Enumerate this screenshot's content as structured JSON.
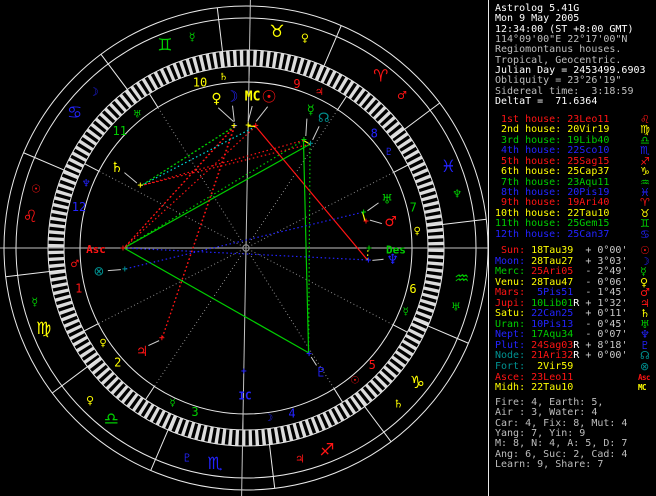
{
  "app_title": "Astrolog 5.41G",
  "palette": {
    "red": "#ff1414",
    "yellow": "#ffff00",
    "green": "#00cd00",
    "blue": "#2323ff",
    "teal": "#009191",
    "cyan": "#00e3e3",
    "white": "#ffffff",
    "gray": "#bdbdbd",
    "ltgray": "#c9c9c9",
    "dim": "#8c8c8c",
    "line": "#eaeaea",
    "axis": "#c2c2c2",
    "pointer": "#cfcfcf",
    "hatch": "#dcdcdc"
  },
  "panel": {
    "header_lines": [
      {
        "text": "Astrolog 5.41G",
        "color": "white"
      },
      {
        "text": "Mon 9 May 2005",
        "color": "white"
      },
      {
        "text": "12:34:00 (ST +8:00 GMT)",
        "color": "white"
      },
      {
        "text": "114°09'00\"E 22°17'00\"N",
        "color": "gray"
      },
      {
        "text": "Regiomontanus houses.",
        "color": "gray"
      },
      {
        "text": "Tropical, Geocentric.",
        "color": "gray"
      },
      {
        "text": "Julian Day = 2453499.6903",
        "color": "white"
      },
      {
        "text": "Obliquity = 23°26'19\"",
        "color": "gray"
      },
      {
        "text": "Sidereal time:  3:18:59",
        "color": "gray"
      },
      {
        "text": "DeltaT =  71.6364",
        "color": "white"
      }
    ],
    "houses": [
      {
        "label": " 1st house:",
        "value": "23Leo11",
        "color": "red",
        "glyph": "♌"
      },
      {
        "label": " 2nd house:",
        "value": "20Vir19",
        "color": "yellow",
        "glyph": "♍"
      },
      {
        "label": " 3rd house:",
        "value": "19Lib40",
        "color": "green",
        "glyph": "♎"
      },
      {
        "label": " 4th house:",
        "value": "22Sco10",
        "color": "blue",
        "glyph": "♏"
      },
      {
        "label": " 5th house:",
        "value": "25Sag15",
        "color": "red",
        "glyph": "♐"
      },
      {
        "label": " 6th house:",
        "value": "25Cap37",
        "color": "yellow",
        "glyph": "♑"
      },
      {
        "label": " 7th house:",
        "value": "23Aqu11",
        "color": "green",
        "glyph": "♒"
      },
      {
        "label": " 8th house:",
        "value": "20Pis19",
        "color": "blue",
        "glyph": "♓"
      },
      {
        "label": " 9th house:",
        "value": "19Ari40",
        "color": "red",
        "glyph": "♈"
      },
      {
        "label": "10th house:",
        "value": "22Tau10",
        "color": "yellow",
        "glyph": "♉"
      },
      {
        "label": "11th house:",
        "value": "25Gem15",
        "color": "green",
        "glyph": "♊"
      },
      {
        "label": "12th house:",
        "value": "25Can37",
        "color": "blue",
        "glyph": "♋"
      }
    ],
    "planets": [
      {
        "label": " Sun:",
        "value": "18Tau39",
        "retro": " ",
        "dev": "+ 0°00'",
        "label_color": "red",
        "value_color": "yellow",
        "glyph": "☉",
        "glyph_color": "red"
      },
      {
        "label": "Moon:",
        "value": "28Tau27",
        "retro": " ",
        "dev": "+ 3°03'",
        "label_color": "blue",
        "value_color": "yellow",
        "glyph": "☽",
        "glyph_color": "blue"
      },
      {
        "label": "Merc:",
        "value": "25Ari05",
        "retro": " ",
        "dev": "- 2°49'",
        "label_color": "green",
        "value_color": "red",
        "glyph": "☿",
        "glyph_color": "green"
      },
      {
        "label": "Venu:",
        "value": "28Tau47",
        "retro": " ",
        "dev": "- 0°06'",
        "label_color": "yellow",
        "value_color": "yellow",
        "glyph": "♀",
        "glyph_color": "yellow"
      },
      {
        "label": "Mars:",
        "value": " 5Pis51",
        "retro": " ",
        "dev": "- 1°45'",
        "label_color": "red",
        "value_color": "blue",
        "glyph": "♂",
        "glyph_color": "red"
      },
      {
        "label": "Jupi:",
        "value": "10Lib01",
        "retro": "R",
        "dev": "+ 1°32'",
        "label_color": "red",
        "value_color": "green",
        "glyph": "♃",
        "glyph_color": "red"
      },
      {
        "label": "Satu:",
        "value": "22Can25",
        "retro": " ",
        "dev": "+ 0°11'",
        "label_color": "yellow",
        "value_color": "blue",
        "glyph": "♄",
        "glyph_color": "yellow"
      },
      {
        "label": "Uran:",
        "value": "10Pis13",
        "retro": " ",
        "dev": "- 0°45'",
        "label_color": "green",
        "value_color": "blue",
        "glyph": "♅",
        "glyph_color": "green"
      },
      {
        "label": "Nept:",
        "value": "17Aqu34",
        "retro": " ",
        "dev": "- 0°07'",
        "label_color": "blue",
        "value_color": "green",
        "glyph": "♆",
        "glyph_color": "blue"
      },
      {
        "label": "Plut:",
        "value": "24Sag03",
        "retro": "R",
        "dev": "+ 8°18'",
        "label_color": "blue",
        "value_color": "red",
        "glyph": "♇",
        "glyph_color": "blue"
      },
      {
        "label": "Node:",
        "value": "21Ari32",
        "retro": "R",
        "dev": "+ 0°00'",
        "label_color": "teal",
        "value_color": "red",
        "glyph": "☊",
        "glyph_color": "teal"
      },
      {
        "label": "Fort:",
        "value": " 2Vir59",
        "retro": " ",
        "dev": "",
        "label_color": "teal",
        "value_color": "yellow",
        "glyph": "⊗",
        "glyph_color": "teal"
      },
      {
        "label": "Asce:",
        "value": "23Leo11",
        "retro": " ",
        "dev": "",
        "label_color": "red",
        "value_color": "red",
        "glyph": "Asc",
        "glyph_color": "red",
        "glyph_text": true
      },
      {
        "label": "Midh:",
        "value": "22Tau10",
        "retro": " ",
        "dev": "",
        "label_color": "yellow",
        "value_color": "yellow",
        "glyph": "MC",
        "glyph_color": "yellow",
        "glyph_text": true
      }
    ],
    "stats_lines": [
      "Fire: 4, Earth: 5,",
      "Air : 3, Water: 4",
      "Car: 4, Fix: 8, Mut: 4",
      "Yang: 7, Yin: 9",
      "M: 8, N: 4, A: 5, D: 7",
      "Ang: 6, Suc: 2, Cad: 4",
      "Learn: 9, Share: 7"
    ]
  },
  "chart_data": {
    "type": "astrology_wheel",
    "asc_lon": 143.183,
    "house_cusps_lon": [
      143.183,
      170.317,
      199.667,
      232.167,
      265.25,
      295.617,
      323.183,
      350.317,
      19.667,
      52.167,
      85.25,
      115.617
    ],
    "house_number_colors": [
      "red",
      "yellow",
      "green",
      "blue",
      "red",
      "yellow",
      "green",
      "blue",
      "red",
      "yellow",
      "green",
      "blue"
    ],
    "house_rulers": [
      {
        "glyph": "♂",
        "color": "red"
      },
      {
        "glyph": "♀",
        "color": "yellow"
      },
      {
        "glyph": "☿",
        "color": "green"
      },
      {
        "glyph": "☽",
        "color": "blue"
      },
      {
        "glyph": "☉",
        "color": "red"
      },
      {
        "glyph": "☿",
        "color": "green"
      },
      {
        "glyph": "♀",
        "color": "yellow"
      },
      {
        "glyph": "♇",
        "color": "blue"
      },
      {
        "glyph": "♃",
        "color": "red"
      },
      {
        "glyph": "♄",
        "color": "yellow"
      },
      {
        "glyph": "♅",
        "color": "green"
      },
      {
        "glyph": "♆",
        "color": "blue"
      }
    ],
    "signs": [
      {
        "name": "Aries",
        "glyph": "♈",
        "color": "red",
        "ruler": "♂",
        "ruler_color": "red"
      },
      {
        "name": "Taurus",
        "glyph": "♉",
        "color": "yellow",
        "ruler": "♀",
        "ruler_color": "yellow"
      },
      {
        "name": "Gemini",
        "glyph": "♊",
        "color": "green",
        "ruler": "☿",
        "ruler_color": "green"
      },
      {
        "name": "Cancer",
        "glyph": "♋",
        "color": "blue",
        "ruler": "☽",
        "ruler_color": "blue"
      },
      {
        "name": "Leo",
        "glyph": "♌",
        "color": "red",
        "ruler": "☉",
        "ruler_color": "red"
      },
      {
        "name": "Virgo",
        "glyph": "♍",
        "color": "yellow",
        "ruler": "☿",
        "ruler_color": "green"
      },
      {
        "name": "Libra",
        "glyph": "♎",
        "color": "green",
        "ruler": "♀",
        "ruler_color": "yellow"
      },
      {
        "name": "Scorpio",
        "glyph": "♏",
        "color": "blue",
        "ruler": "♇",
        "ruler_color": "blue"
      },
      {
        "name": "Sagittarius",
        "glyph": "♐",
        "color": "red",
        "ruler": "♃",
        "ruler_color": "red"
      },
      {
        "name": "Capricorn",
        "glyph": "♑",
        "color": "yellow",
        "ruler": "♄",
        "ruler_color": "yellow"
      },
      {
        "name": "Aquarius",
        "glyph": "♒",
        "color": "green",
        "ruler": "♅",
        "ruler_color": "green"
      },
      {
        "name": "Pisces",
        "glyph": "♓",
        "color": "blue",
        "ruler": "♆",
        "ruler_color": "green"
      }
    ],
    "planets": [
      {
        "name": "Sun",
        "glyph": "☉",
        "color": "red",
        "lon": 48.65,
        "pos": "18Tau39",
        "disp": 81.3,
        "rg": 152,
        "size": 17
      },
      {
        "name": "Moon",
        "glyph": "☽",
        "color": "blue",
        "lon": 58.45,
        "pos": "28Tau27",
        "disp": 95.4,
        "rg": 152,
        "size": 15
      },
      {
        "name": "Mercury",
        "glyph": "☿",
        "color": "green",
        "lon": 25.083,
        "pos": "25Ari05",
        "disp": 64.8,
        "rg": 152,
        "size": 13
      },
      {
        "name": "Venus",
        "glyph": "♀",
        "color": "yellow",
        "lon": 58.783,
        "pos": "28Tau47",
        "disp": 101.2,
        "rg": 152,
        "size": 14
      },
      {
        "name": "Mars",
        "glyph": "♂",
        "color": "red",
        "lon": 335.85,
        "pos": "5Pis51",
        "disp": 10.2,
        "rg": 147,
        "size": 14
      },
      {
        "name": "Jupiter",
        "glyph": "♃",
        "color": "red",
        "lon": 190.017,
        "pos": "10Lib01R",
        "disp": 225.0,
        "rg": 147,
        "size": 14
      },
      {
        "name": "Saturn",
        "glyph": "♄",
        "color": "yellow",
        "lon": 112.417,
        "pos": "22Can25",
        "disp": 148.2,
        "rg": 152,
        "size": 14
      },
      {
        "name": "Uranus",
        "glyph": "♅",
        "color": "green",
        "lon": 340.217,
        "pos": "10Pis13",
        "disp": 18.8,
        "rg": 149,
        "size": 13
      },
      {
        "name": "Neptune",
        "glyph": "♆",
        "color": "blue",
        "lon": 317.567,
        "pos": "17Aqu34",
        "disp": 355.3,
        "rg": 147,
        "size": 14
      },
      {
        "name": "Pluto",
        "glyph": "♇",
        "color": "blue",
        "lon": 264.05,
        "pos": "24Sag03R",
        "disp": 301.0,
        "rg": 146,
        "size": 13
      },
      {
        "name": "Node",
        "glyph": "☊",
        "color": "teal",
        "lon": 21.533,
        "pos": "21Ari32R",
        "disp": 59.0,
        "rg": 151,
        "size": 13
      },
      {
        "name": "Fortune",
        "glyph": "⊗",
        "color": "teal",
        "lon": 152.983,
        "pos": "2Vir59",
        "disp": 189.3,
        "rg": 149,
        "size": 13
      }
    ],
    "angles": [
      {
        "name": "MC",
        "text": "MC",
        "color": "yellow",
        "lon": 52.167,
        "disp": 87.5,
        "rg": 151,
        "size": 13,
        "pointer": true
      },
      {
        "name": "Asc",
        "text": "Asc",
        "color": "red",
        "lon": 143.183,
        "disp": 180.5,
        "rg": 150,
        "size": 11,
        "pointer": false
      },
      {
        "name": "Des",
        "text": "Des",
        "color": "green",
        "lon": 323.183,
        "disp": 359.2,
        "rg": 150,
        "size": 11,
        "pointer": false
      },
      {
        "name": "IC",
        "text": "IC",
        "color": "blue",
        "lon": 232.167,
        "disp": 269.6,
        "rg": 148,
        "size": 11,
        "pointer": false
      }
    ],
    "aspects": [
      {
        "from": "Sun",
        "to": "Neptune",
        "color": "red",
        "style": "solid"
      },
      {
        "from": "Node",
        "to": "Asc",
        "color": "green",
        "style": "solid"
      },
      {
        "from": "Mercury",
        "to": "Pluto",
        "color": "green",
        "style": "solid"
      },
      {
        "from": "Asc",
        "to": "Pluto",
        "color": "green",
        "style": "solid"
      },
      {
        "from": "Mercury",
        "to": "Asc",
        "color": "green",
        "style": "dotted"
      },
      {
        "from": "Node",
        "to": "Pluto",
        "color": "green",
        "style": "dotted"
      },
      {
        "from": "Venus",
        "to": "Saturn",
        "color": "green",
        "style": "dotted"
      },
      {
        "from": "Moon",
        "to": "Saturn",
        "color": "green",
        "style": "dotted"
      },
      {
        "from": "Mercury",
        "to": "Saturn",
        "color": "red",
        "style": "dotted"
      },
      {
        "from": "Node",
        "to": "Saturn",
        "color": "red",
        "style": "dotted"
      },
      {
        "from": "Moon",
        "to": "Asc",
        "color": "red",
        "style": "dotted"
      },
      {
        "from": "Venus",
        "to": "Asc",
        "color": "red",
        "style": "dotted"
      },
      {
        "from": "Sun",
        "to": "Asc",
        "color": "red",
        "style": "dotted"
      },
      {
        "from": "Moon",
        "to": "Jupiter",
        "color": "red",
        "style": "dotted"
      },
      {
        "from": "Venus",
        "to": "Jupiter",
        "color": "red",
        "style": "dotted"
      },
      {
        "from": "Sun",
        "to": "Saturn",
        "color": "cyan",
        "style": "dotted"
      },
      {
        "from": "Asc",
        "to": "Neptune",
        "color": "blue",
        "style": "dotted"
      },
      {
        "from": "Fortune",
        "to": "Uranus",
        "color": "blue",
        "style": "dotted"
      },
      {
        "from": "Sun",
        "to": "MC",
        "color": "yellow",
        "style": "solid"
      },
      {
        "from": "Mercury",
        "to": "Node",
        "color": "yellow",
        "style": "solid"
      },
      {
        "from": "Mars",
        "to": "Uranus",
        "color": "yellow",
        "style": "solid"
      },
      {
        "from": "Neptune",
        "to": "Des",
        "color": "yellow",
        "style": "dotted"
      }
    ]
  }
}
